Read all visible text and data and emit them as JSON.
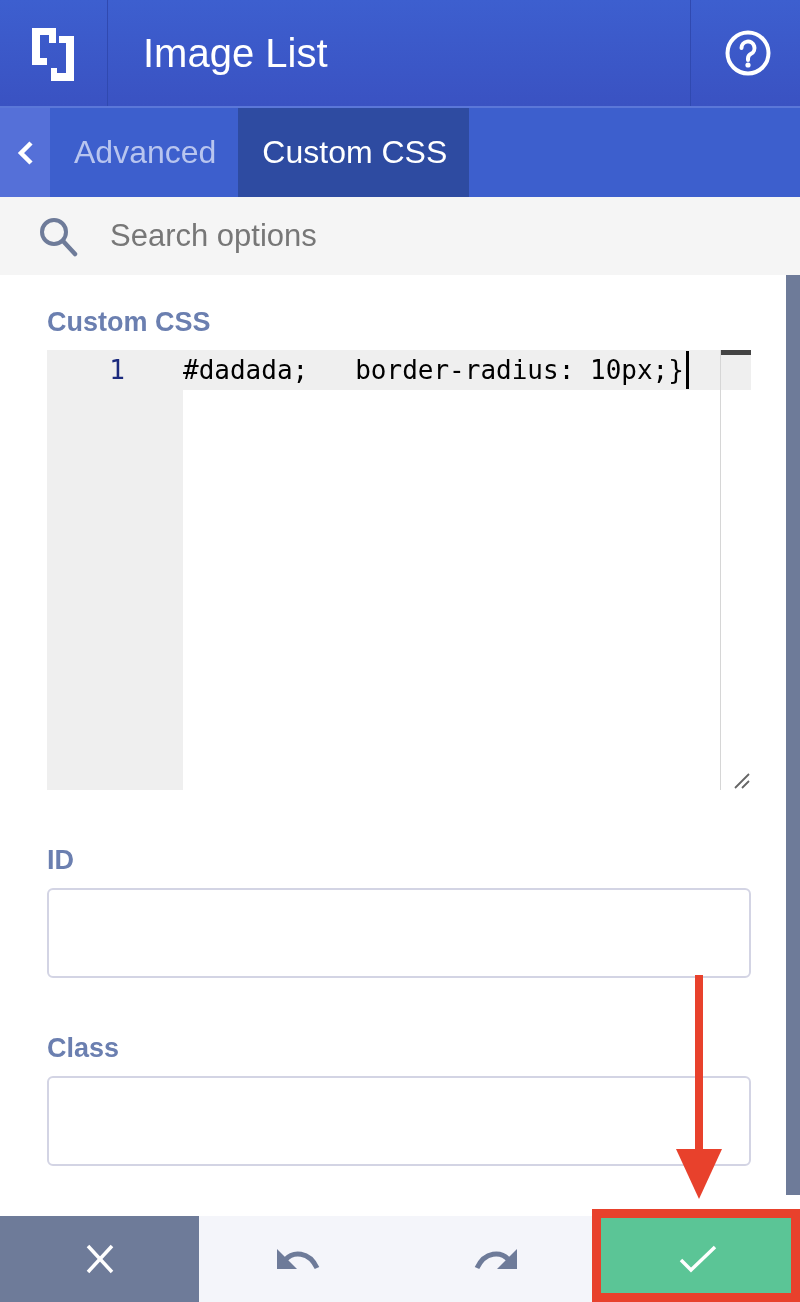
{
  "header": {
    "title": "Image List"
  },
  "tabs": [
    {
      "label": "Advanced",
      "selected": false
    },
    {
      "label": "Custom CSS",
      "selected": true
    }
  ],
  "search": {
    "placeholder": "Search options"
  },
  "fields": [
    {
      "kind": "code",
      "label": "Custom CSS",
      "lines": [
        {
          "number": "1",
          "text": "#dadada;   border-radius: 10px;}",
          "active": true
        }
      ]
    },
    {
      "kind": "text",
      "label": "ID"
    },
    {
      "kind": "text",
      "label": "Class"
    }
  ],
  "footer": {
    "buttons": [
      {
        "kind": "cancel",
        "highlighted": false
      },
      {
        "kind": "undo",
        "highlighted": false
      },
      {
        "kind": "redo",
        "highlighted": false
      },
      {
        "kind": "save",
        "highlighted": true
      }
    ]
  }
}
